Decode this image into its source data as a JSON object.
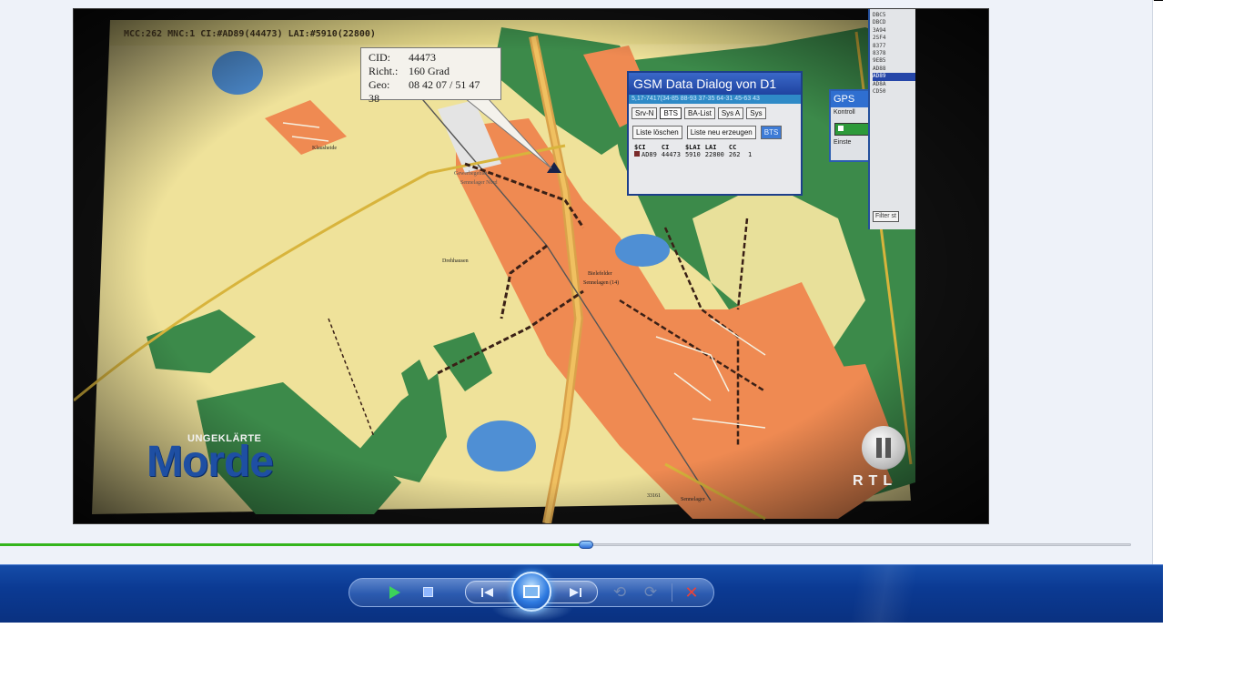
{
  "player": {
    "video": {
      "overlay_bar": "MCC:262 MNC:1 CI:#AD89(44473) LAI:#5910(22800)",
      "callout": {
        "cid_key": "CID:",
        "cid_val": "44473",
        "richt_key": "Richt.:",
        "richt_val": "160 Grad",
        "geo_key": "Geo:",
        "geo_val": "08 42 07 / 51 47 38"
      },
      "gsm_dialog": {
        "title": "GSM Data Dialog von D1",
        "subtitle": "5,17-7417(34-85 88-93 37-35 64-31 45-63 43",
        "tabs": [
          "Srv-N",
          "BTS",
          "BA-List",
          "Sys A",
          "Sys"
        ],
        "buttons": [
          "Liste löschen",
          "Liste neu erzeugen",
          "BTS"
        ],
        "columns": [
          "$CI",
          "CI",
          "$LAI",
          "LAI",
          "CC"
        ],
        "rows": [
          [
            "AD89",
            "44473",
            "5910",
            "22800",
            "262",
            "1"
          ]
        ]
      },
      "gps_dialog": {
        "title": "GPS",
        "line1": "Kontroll",
        "line2": "Einste"
      },
      "list_panel": {
        "items": [
          "DBC5",
          "DBCD",
          "3A94",
          "2SF4",
          "8377",
          "8378",
          "9EB5",
          "AD88",
          "AD89",
          "AD8A",
          "CD50"
        ],
        "selected_index": 8,
        "filter_label": "Filter st"
      },
      "map_labels": {
        "klausheide": "Klausheide",
        "gewerbegebiet": "Gewerbegebiet",
        "sennelager_nord": "Sennelager Nord",
        "drehhausen": "Drehhausen",
        "bielefelder": "Bielefelder",
        "sennelagen_14": "Sennelagen (14)",
        "sennelager_s": "Sennelager",
        "road_1": "33161"
      },
      "logo": {
        "small": "UNGEKLÄRTE",
        "big": "Morde"
      },
      "channel": "RTL"
    },
    "seek": {
      "progress": 0.512
    },
    "controls": {
      "play": "play",
      "stop": "stop",
      "prev": "previous",
      "now_playing": "switch-to-now-playing",
      "next": "next",
      "rewind": "replay",
      "forward": "forward",
      "close": "close"
    },
    "colors": {
      "map_yellow": "#efe29a",
      "map_orange": "#ef8a52",
      "map_green": "#3c8a4a",
      "map_blue": "#4f8fd4",
      "bar_blue": "#0b3a93",
      "seek_green": "#34b51c"
    }
  }
}
